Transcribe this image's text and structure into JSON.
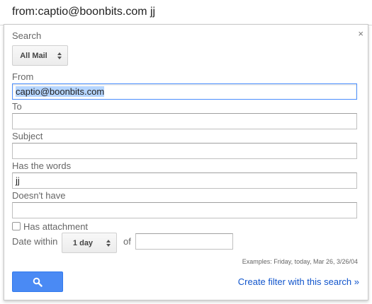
{
  "search_bar": {
    "query": "from:captio@boonbits.com jj"
  },
  "panel": {
    "close_glyph": "×",
    "search_label": "Search",
    "search_scope": "All Mail",
    "from_label": "From",
    "from_value": "captio@boonbits.com",
    "to_label": "To",
    "to_value": "",
    "subject_label": "Subject",
    "subject_value": "",
    "has_words_label": "Has the words",
    "has_words_value": "jj",
    "doesnt_have_label": "Doesn't have",
    "doesnt_have_value": "",
    "attachment_label": "Has attachment",
    "date_within_label": "Date within",
    "date_within_value": "1 day",
    "of_label": "of",
    "of_value": "",
    "examples": "Examples: Friday, today, Mar 26, 3/26/04",
    "create_filter_link": "Create filter with this search »"
  },
  "icons": {
    "search_button_icon": "magnifier-icon"
  },
  "colors": {
    "accent": "#4a8af4",
    "link": "#1155cc",
    "focus": "#4d90fe",
    "selection": "#b5d5ff"
  }
}
